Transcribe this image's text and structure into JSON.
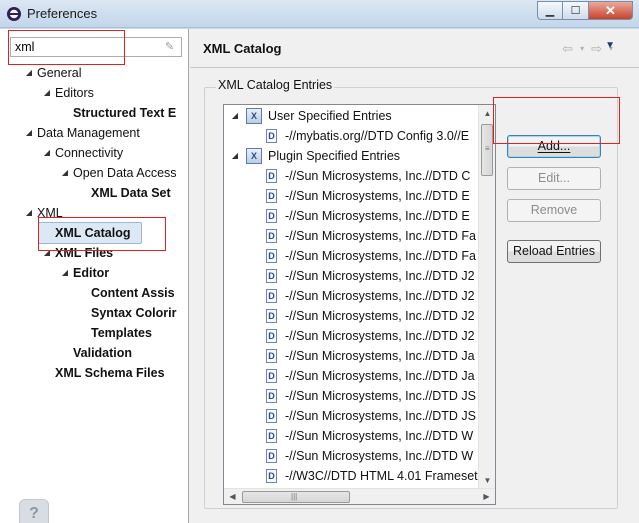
{
  "window": {
    "title": "Preferences"
  },
  "filter": {
    "value": "xml"
  },
  "tree": [
    {
      "label": "General",
      "twisty": "◢",
      "bold": false
    },
    {
      "label": "Editors",
      "twisty": "◢",
      "bold": false
    },
    {
      "label": "Structured Text E",
      "twisty": "",
      "bold": true
    },
    {
      "label": "Data Management",
      "twisty": "◢",
      "bold": false
    },
    {
      "label": "Connectivity",
      "twisty": "◢",
      "bold": false
    },
    {
      "label": "Open Data Access",
      "twisty": "◢",
      "bold": false
    },
    {
      "label": "XML Data Set",
      "twisty": "",
      "bold": true
    },
    {
      "label": "XML",
      "twisty": "◢",
      "bold": false
    },
    {
      "label": "XML Catalog",
      "twisty": "",
      "bold": true
    },
    {
      "label": "XML Files",
      "twisty": "◢",
      "bold": true
    },
    {
      "label": "Editor",
      "twisty": "◢",
      "bold": true
    },
    {
      "label": "Content Assis",
      "twisty": "",
      "bold": true
    },
    {
      "label": "Syntax Colorir",
      "twisty": "",
      "bold": true
    },
    {
      "label": "Templates",
      "twisty": "",
      "bold": true
    },
    {
      "label": "Validation",
      "twisty": "",
      "bold": true
    },
    {
      "label": "XML Schema Files",
      "twisty": "",
      "bold": true
    }
  ],
  "page": {
    "title": "XML Catalog",
    "group_label": "XML Catalog Entries"
  },
  "entries": [
    {
      "label": "User Specified Entries",
      "kind": "category",
      "twisty": "◢"
    },
    {
      "label": "-//mybatis.org//DTD Config 3.0//E",
      "kind": "dtd",
      "twisty": ""
    },
    {
      "label": "Plugin Specified Entries",
      "kind": "category",
      "twisty": "◢"
    },
    {
      "label": "-//Sun Microsystems, Inc.//DTD C",
      "kind": "dtd",
      "twisty": ""
    },
    {
      "label": "-//Sun Microsystems, Inc.//DTD E",
      "kind": "dtd",
      "twisty": ""
    },
    {
      "label": "-//Sun Microsystems, Inc.//DTD E",
      "kind": "dtd",
      "twisty": ""
    },
    {
      "label": "-//Sun Microsystems, Inc.//DTD Fa",
      "kind": "dtd",
      "twisty": ""
    },
    {
      "label": "-//Sun Microsystems, Inc.//DTD Fa",
      "kind": "dtd",
      "twisty": ""
    },
    {
      "label": "-//Sun Microsystems, Inc.//DTD J2",
      "kind": "dtd",
      "twisty": ""
    },
    {
      "label": "-//Sun Microsystems, Inc.//DTD J2",
      "kind": "dtd",
      "twisty": ""
    },
    {
      "label": "-//Sun Microsystems, Inc.//DTD J2",
      "kind": "dtd",
      "twisty": ""
    },
    {
      "label": "-//Sun Microsystems, Inc.//DTD J2",
      "kind": "dtd",
      "twisty": ""
    },
    {
      "label": "-//Sun Microsystems, Inc.//DTD Ja",
      "kind": "dtd",
      "twisty": ""
    },
    {
      "label": "-//Sun Microsystems, Inc.//DTD Ja",
      "kind": "dtd",
      "twisty": ""
    },
    {
      "label": "-//Sun Microsystems, Inc.//DTD JS",
      "kind": "dtd",
      "twisty": ""
    },
    {
      "label": "-//Sun Microsystems, Inc.//DTD JS",
      "kind": "dtd",
      "twisty": ""
    },
    {
      "label": "-//Sun Microsystems, Inc.//DTD W",
      "kind": "dtd",
      "twisty": ""
    },
    {
      "label": "-//Sun Microsystems, Inc.//DTD W",
      "kind": "dtd",
      "twisty": ""
    },
    {
      "label": "-//W3C//DTD HTML 4.01 Frameset",
      "kind": "dtd",
      "twisty": ""
    }
  ],
  "buttons": {
    "add": "Add...",
    "edit": "Edit...",
    "remove": "Remove",
    "reload": "Reload Entries"
  },
  "icons": {
    "app": "eclipse-icon",
    "dtd_glyph": "D",
    "category_glyph": "X",
    "help_glyph": "?"
  },
  "colors": {
    "highlight": "#dd2222",
    "selection": "#dde8f5"
  }
}
